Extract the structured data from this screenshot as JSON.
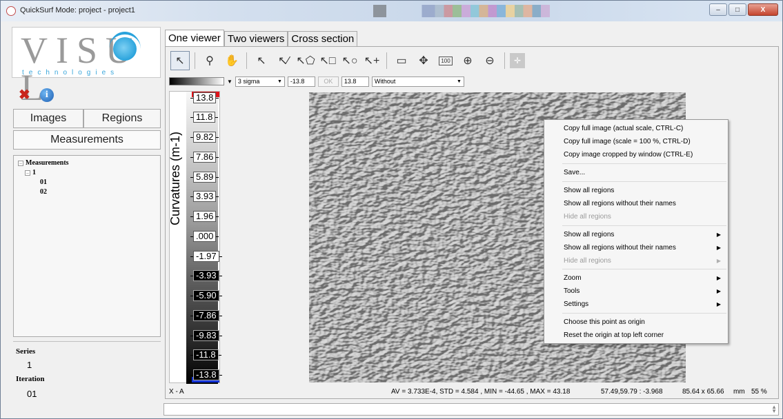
{
  "window": {
    "title": "QuickSurf Mode: project - project1",
    "buttons": {
      "minimize": "–",
      "maximize": "□",
      "close": "X"
    }
  },
  "logo": {
    "word": "VISU L",
    "subtitle": "technologies"
  },
  "left": {
    "tab_images": "Images",
    "tab_regions": "Regions",
    "tab_measurements": "Measurements",
    "tree": {
      "root": "Measurements",
      "child": "1",
      "leaves": [
        "01",
        "02"
      ]
    },
    "series_label": "Series",
    "series_value": "1",
    "iteration_label": "Iteration",
    "iteration_value": "01"
  },
  "tabs": [
    "One viewer",
    "Two viewers",
    "Cross section"
  ],
  "controls": {
    "sigma": "3 sigma",
    "min": "-13.8",
    "ok": "OK",
    "max": "13.8",
    "filter": "Without"
  },
  "scale": {
    "axis_label": "Curvatures (m-1)",
    "ticks": [
      "13.8",
      "11.8",
      "9.82",
      "7.86",
      "5.89",
      "3.93",
      "1.96",
      ".000",
      "-1.97",
      "-3.93",
      "-5.90",
      "-7.86",
      "-9.83",
      "-11.8",
      "-13.8"
    ],
    "top_color": "#e0141b",
    "bottom_color": "#1232d8"
  },
  "context_menu": {
    "items": [
      {
        "label": "Copy full image (actual scale, CTRL-C)",
        "enabled": true,
        "submenu": false
      },
      {
        "label": "Copy full image (scale = 100 %, CTRL-D)",
        "enabled": true,
        "submenu": false
      },
      {
        "label": "Copy image cropped by window (CTRL-E)",
        "enabled": true,
        "submenu": false
      },
      {
        "label": "Save...",
        "enabled": true,
        "submenu": false
      },
      {
        "label": "Show all regions",
        "enabled": true,
        "submenu": false
      },
      {
        "label": "Show all regions without their names",
        "enabled": true,
        "submenu": false
      },
      {
        "label": "Hide all regions",
        "enabled": false,
        "submenu": false
      },
      {
        "label": "Show all regions",
        "enabled": true,
        "submenu": true
      },
      {
        "label": "Show all regions without their names",
        "enabled": true,
        "submenu": true
      },
      {
        "label": "Hide all regions",
        "enabled": false,
        "submenu": true
      },
      {
        "label": "Zoom",
        "enabled": true,
        "submenu": true
      },
      {
        "label": "Tools",
        "enabled": true,
        "submenu": true
      },
      {
        "label": "Settings",
        "enabled": true,
        "submenu": true
      },
      {
        "label": "Choose this point as origin",
        "enabled": true,
        "submenu": false
      },
      {
        "label": "Reset the origin at top left corner",
        "enabled": true,
        "submenu": false
      }
    ]
  },
  "status": {
    "profile": "X - A",
    "stats": "AV = 3.733E-4, STD = 4.584 , MIN = -44.65 , MAX = 43.18",
    "cursor": "57.49,59.79 : -3.968",
    "size": "85.64 x 65.66",
    "unit": "mm",
    "zoom": "55 %"
  }
}
